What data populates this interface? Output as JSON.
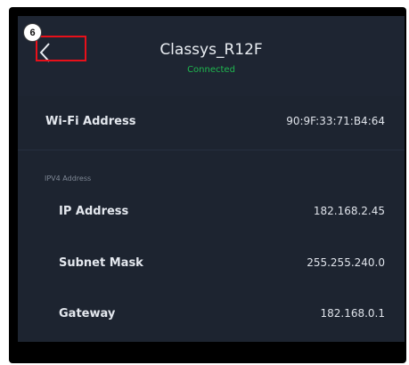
{
  "step_badge": "6",
  "header": {
    "title": "Classys_R12F",
    "status": "Connected"
  },
  "wifi": {
    "label": "Wi-Fi Address",
    "value": "90:9F:33:71:B4:64"
  },
  "ipv4": {
    "section_label": "IPV4 Address",
    "items": [
      {
        "label": "IP Address",
        "value": "182.168.2.45"
      },
      {
        "label": "Subnet Mask",
        "value": "255.255.240.0"
      },
      {
        "label": "Gateway",
        "value": "182.168.0.1"
      }
    ]
  },
  "colors": {
    "background": "#1d2430",
    "status_green": "#1fb84f",
    "highlight_red": "#e8101a"
  }
}
